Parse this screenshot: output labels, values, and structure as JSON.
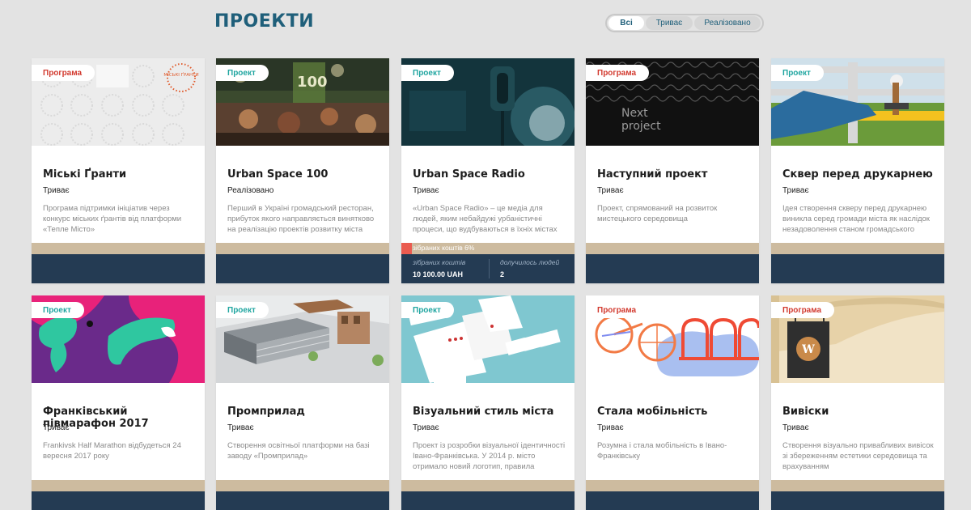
{
  "page": {
    "title": "ПРОЕКТИ"
  },
  "filters": {
    "all": "Всі",
    "ongoing": "Триває",
    "done": "Реалізовано",
    "active": "all"
  },
  "colors": {
    "program_badge": "#d23a2f",
    "project_badge": "#1fa5a0",
    "title": "#1f5f7a",
    "footer_navy": "#243b53",
    "footer_tan": "#cdbb9f",
    "progress_red": "#ea5b4f"
  },
  "cards": [
    {
      "badge": "Програма",
      "title": "Міські Ґранти",
      "status": "Триває",
      "description": "Програма підтримки ініціатив через конкурс міських ґрантів від платформи «Тепле Місто»",
      "image_text": "МІСЬКІ ҐРАНТИ"
    },
    {
      "badge": "Проект",
      "title": "Urban Space 100",
      "status": "Реалізовано",
      "description": "Перший в Україні громадський ресторан, прибуток якого направляється винятково на реалізацію проектів розвитку міста"
    },
    {
      "badge": "Проект",
      "title": "Urban Space Radio",
      "status": "Триває",
      "description": "«Urban Space Radio» – це медіа для людей, яким небайдужі урбаністичні процеси, що вудбуваються в їхніх містах",
      "progress": {
        "label": "зібраних коштів 6%",
        "percent": 6
      },
      "stats": {
        "collected_label": "зібраних коштів",
        "collected_value": "10 100.00 UAH",
        "joined_label": "долучилось людей",
        "joined_value": "2"
      }
    },
    {
      "badge": "Програма",
      "title": "Наступний проект",
      "status": "Триває",
      "description": "Проект, спрямований на розвиток мистецького середовища",
      "image_text_line1": "Next",
      "image_text_line2": "project"
    },
    {
      "badge": "Проект",
      "title": "Сквер перед друкарнею",
      "status": "Триває",
      "description": "Ідея створення скверу перед друкарнею виникла серед громади міста як наслідок незадоволення станом громадського"
    },
    {
      "badge": "Проект",
      "title": "Франківський півмарафон 2017",
      "status": "Триває",
      "description": "Frankivsk Half Marathon відбудеться 24 вересня 2017 року"
    },
    {
      "badge": "Проект",
      "title": "Промприлад",
      "status": "Триває",
      "description": "Створення освітньої платформи на базі заводу «Промприлад»"
    },
    {
      "badge": "Проект",
      "title": "Візуальний стиль міста",
      "status": "Триває",
      "description": "Проект із розробки візуальної ідентичності Івано-Франківська. У 2014 р. місто отримало новий логотип, правила"
    },
    {
      "badge": "Програма",
      "title": "Стала мобільність",
      "status": "Триває",
      "description": "Розумна і стала мобільність в Івано-Франківську"
    },
    {
      "badge": "Програма",
      "title": "Вивіски",
      "status": "Триває",
      "description": "Створення візуально привабливих вивісок зі збереженням естетики середовища та врахуванням",
      "image_text": "W"
    }
  ]
}
